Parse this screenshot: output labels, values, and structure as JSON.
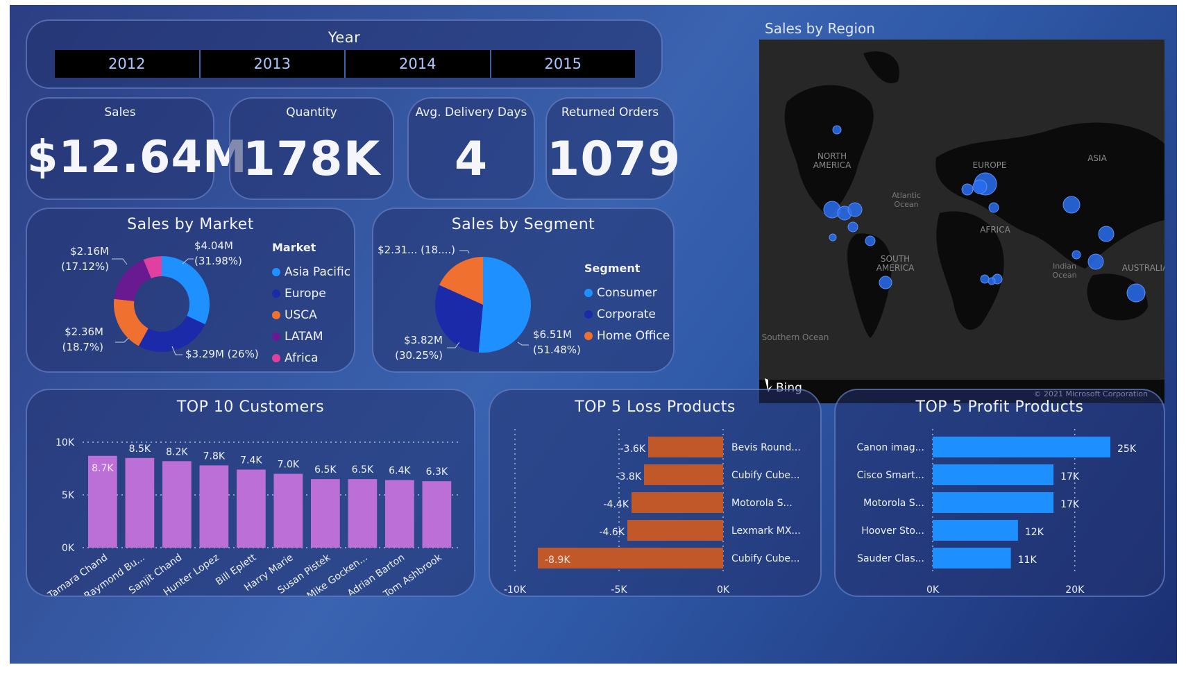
{
  "year_slicer": {
    "title": "Year",
    "years": [
      "2012",
      "2013",
      "2014",
      "2015"
    ]
  },
  "kpis": {
    "sales": {
      "title": "Sales",
      "value": "$12.64M"
    },
    "quantity": {
      "title": "Quantity",
      "value": "178K"
    },
    "delivery": {
      "title": "Avg. Delivery Days",
      "value": "4"
    },
    "returned": {
      "title": "Returned Orders",
      "value": "1079"
    }
  },
  "market": {
    "title": "Sales by Market",
    "legend_title": "Market",
    "items": [
      {
        "name": "Asia Pacific",
        "value": 31.98,
        "color": "#1e90ff",
        "label1": "$4.04M",
        "label2": "(31.98%)"
      },
      {
        "name": "Europe",
        "value": 26,
        "color": "#1a2aa8",
        "label1": "$3.29M (26%)",
        "label2": ""
      },
      {
        "name": "USCA",
        "value": 18.7,
        "color": "#f07030",
        "label1": "$2.36M",
        "label2": "(18.7%)"
      },
      {
        "name": "LATAM",
        "value": 17.12,
        "color": "#6a1a90",
        "label1": "$2.16M",
        "label2": "(17.12%)"
      },
      {
        "name": "Africa",
        "value": 6.2,
        "color": "#e040a0",
        "label1": "",
        "label2": ""
      }
    ]
  },
  "segment": {
    "title": "Sales by Segment",
    "legend_title": "Segment",
    "items": [
      {
        "name": "Consumer",
        "value": 51.48,
        "color": "#1e90ff",
        "label1": "$6.51M",
        "label2": "(51.48%)"
      },
      {
        "name": "Corporate",
        "value": 30.25,
        "color": "#1a2aa8",
        "label1": "$3.82M",
        "label2": "(30.25%)"
      },
      {
        "name": "Home Office",
        "value": 18.27,
        "color": "#f07030",
        "label1": "$2.31... (18....)",
        "label2": ""
      }
    ]
  },
  "map": {
    "title": "Sales by Region",
    "labels": [
      "NORTH AMERICA",
      "EUROPE",
      "ASIA",
      "AFRICA",
      "SOUTH AMERICA",
      "Atlantic Ocean",
      "Indian Ocean",
      "AUSTRALIA",
      "Southern Ocean"
    ],
    "bing": "Bing",
    "copyright": "© 2021 Microsoft Corporation",
    "bubble_color": "#2a6ff0"
  },
  "customers": {
    "title": "TOP 10 Customers",
    "chart_data": {
      "type": "bar",
      "categories": [
        "Tamara Chand",
        "Raymond Bu...",
        "Sanjit Chand",
        "Hunter Lopez",
        "Bill Eplett",
        "Harry Marie",
        "Susan Pistek",
        "Mike Gocken...",
        "Adrian Barton",
        "Tom Ashbrook"
      ],
      "values": [
        8.7,
        8.5,
        8.2,
        7.8,
        7.4,
        7.0,
        6.5,
        6.5,
        6.4,
        6.3
      ],
      "data_labels": [
        "8.7K",
        "8.5K",
        "8.2K",
        "7.8K",
        "7.4K",
        "7.0K",
        "6.5K",
        "6.5K",
        "6.4K",
        "6.3K"
      ],
      "yticks": [
        "0K",
        "5K",
        "10K"
      ],
      "ylim": [
        0,
        10
      ],
      "color": "#bd6fd8"
    }
  },
  "loss": {
    "title": "TOP 5 Loss Products",
    "chart_data": {
      "type": "bar",
      "categories": [
        "Bevis Round...",
        "Cubify Cube...",
        "Motorola S...",
        "Lexmark MX...",
        "Cubify Cube..."
      ],
      "values": [
        -3.6,
        -3.8,
        -4.4,
        -4.6,
        -8.9
      ],
      "data_labels": [
        "-3.6K",
        "-3.8K",
        "-4.4K",
        "-4.6K",
        "-8.9K"
      ],
      "xticks": [
        "-10K",
        "-5K",
        "0K"
      ],
      "xlim": [
        -10,
        0
      ],
      "color": "#c0582a"
    }
  },
  "profit": {
    "title": "TOP 5 Profit Products",
    "chart_data": {
      "type": "bar",
      "categories": [
        "Canon imag...",
        "Cisco Smart...",
        "Motorola S...",
        "Hoover Sto...",
        "Sauder Clas..."
      ],
      "values": [
        25,
        17,
        17,
        12,
        11
      ],
      "data_labels": [
        "25K",
        "17K",
        "17K",
        "12K",
        "11K"
      ],
      "xticks": [
        "0K",
        "20K"
      ],
      "xlim": [
        0,
        25
      ],
      "color": "#1e8fff"
    }
  }
}
